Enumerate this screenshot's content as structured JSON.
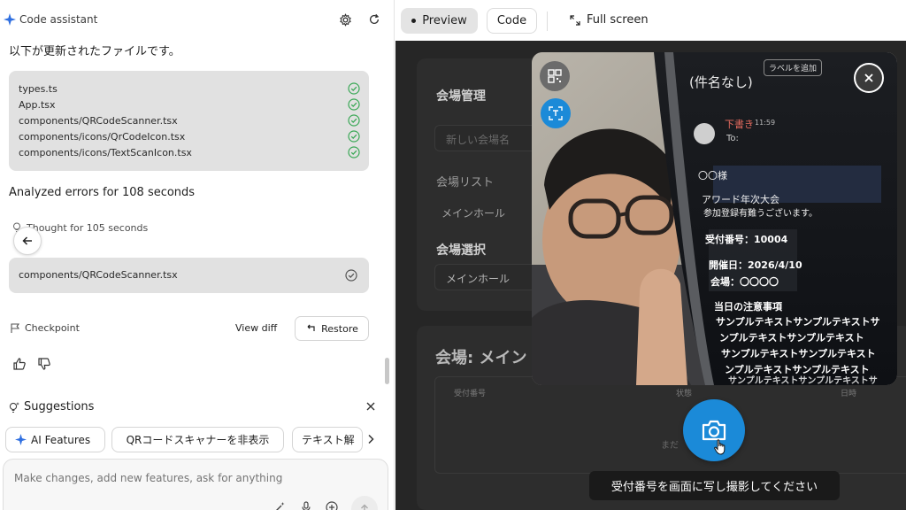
{
  "assistant": {
    "title": "Code assistant",
    "intro": "以下が更新されたファイルです。",
    "files": [
      "types.ts",
      "App.tsx",
      "components/QRCodeScanner.tsx",
      "components/icons/QrCodeIcon.tsx",
      "components/icons/TextScanIcon.tsx"
    ],
    "analyzed": "Analyzed errors for 108 seconds",
    "thought": "Thought for 105 seconds",
    "scanner_file": "components/QRCodeScanner.tsx",
    "checkpoint": "Checkpoint",
    "view_diff": "View diff",
    "restore": "Restore",
    "suggestions_title": "Suggestions",
    "chips": [
      "AI Features",
      "QRコードスキャナーを非表示",
      "テキスト解"
    ],
    "input_placeholder": "Make changes, add new features, ask for anything"
  },
  "toolbar": {
    "preview": "Preview",
    "code": "Code",
    "full_screen": "Full screen"
  },
  "app": {
    "venue_manage": "会場管理",
    "new_venue_placeholder": "新しい会場名",
    "venue_list": "会場リスト",
    "main_hall": "メインホール",
    "venue_select": "会場選択",
    "selected_hall": "メインホール",
    "venue_heading": "会場: メイン",
    "col_receipt": "受付番号",
    "col_status": "状態",
    "col_date": "日時",
    "empty": "まだ"
  },
  "phone_screen": {
    "subject": "(件名なし)",
    "add_label": "ラベルを追加",
    "draft": "下書き",
    "time": "11:59",
    "to": "To:",
    "greeting": "〇〇様",
    "line1": "アワード年次大会",
    "line2": "参加登録有難うございます。",
    "receipt": "受付番号：10004",
    "date": "開催日：2026/4/10",
    "venue": "会場：〇〇〇〇",
    "notes_title": "当日の注意事項",
    "sample1": "サンプルテキストサンプルテキストサ",
    "sample2": "ンプルテキストサンプルテキスト",
    "sample3": "サンプルテキストサンプルテキスト",
    "sample4": "ンプルテキストサンプルテキスト",
    "sample5": "サンプルテキストサンプルテキストサ"
  },
  "camera_hint": "受付番号を画面に写し撮影してください",
  "colors": {
    "accent": "#1b8ad8",
    "check": "#3aa856"
  }
}
